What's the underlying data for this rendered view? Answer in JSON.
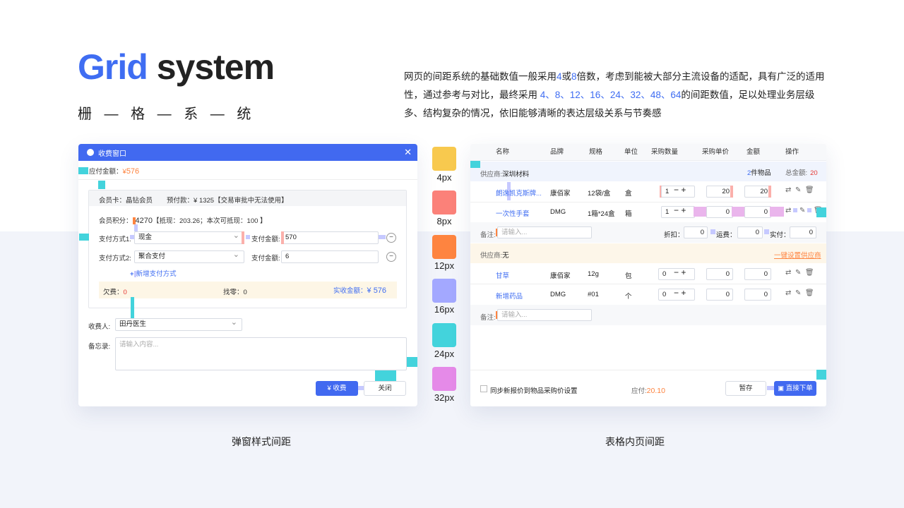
{
  "header": {
    "title_part1": "Grid",
    "title_part2": "system",
    "subtitle": "栅 — 格 — 系 — 统",
    "desc_a": "网页的间距系统的基础数值一般采用",
    "desc_4": "4",
    "desc_b": "或",
    "desc_8": "8",
    "desc_c": "倍数，考虑到能被大部分主流设备的适配，具有广泛的适用性，通过参考与对比，最终采用 ",
    "desc_vals": "4、8、12、16、24、32、48、64",
    "desc_d": "的间距数值，足以处理业务层级多、结构复杂的情况，依旧能够清晰的表达层级关系与节奏感"
  },
  "captions": {
    "dialog": "弹窗样式间距",
    "table": "表格内页间距"
  },
  "legend": [
    {
      "label": "4px",
      "color": "#f8c94e"
    },
    {
      "label": "8px",
      "color": "#fb8179"
    },
    {
      "label": "12px",
      "color": "#fe8440"
    },
    {
      "label": "16px",
      "color": "#a3a8ff"
    },
    {
      "label": "24px",
      "color": "#43d3dc"
    },
    {
      "label": "32px",
      "color": "#e58ae8"
    }
  ],
  "dialog": {
    "title": "收费窗口",
    "due_label": "应付金额：",
    "due_currency": "¥",
    "due_value": "576",
    "member_card_label": "会员卡：",
    "member_card_value": "晶钻会员",
    "prepaid_label": "预付款：",
    "prepaid_value": "¥ 1325【交易审批中无法使用】",
    "points_label": "会员积分：",
    "points_value": "4270",
    "points_note": "【抵现：203.26；本次可抵现：100 】",
    "pay1_label": "支付方式1:",
    "pay1_value": "现金",
    "pay1_amount_label": "支付金额:",
    "pay1_amount": "570",
    "pay2_label": "支付方式2:",
    "pay2_value": "聚合支付",
    "pay2_amount_label": "支付金额:",
    "pay2_amount": "6",
    "add_pay": "新增支付方式",
    "owe_label": "欠费：",
    "owe_value": "0",
    "change_label": "找零：",
    "change_value": "0",
    "received_label": "实收金额：",
    "received_value": "¥ 576",
    "cashier_label": "收费人:",
    "cashier_value": "田丹医生",
    "memo_label": "备忘录:",
    "memo_placeholder": "请输入内容...",
    "charge_button": "¥ 收费",
    "close_button": "关闭"
  },
  "table": {
    "headers": [
      "名称",
      "品牌",
      "规格",
      "单位",
      "采购数量",
      "采购单价",
      "金额",
      "操作"
    ],
    "supplier1_label": "供应商:",
    "supplier1_name": "深圳材料",
    "supplier1_count": "2",
    "supplier1_count_unit": "件物品",
    "supplier1_total_label": "总金额:",
    "supplier1_total": "20",
    "rows1": [
      {
        "name": "朗逸凯克斯牌...",
        "brand": "康佰家",
        "spec": "12袋/盒",
        "unit": "盒",
        "qty": "1",
        "price": "20",
        "amount": "20"
      },
      {
        "name": "一次性手套",
        "brand": "DMG",
        "spec": "1箱*24盒",
        "unit": "箱",
        "qty": "1",
        "price": "0",
        "amount": "0"
      }
    ],
    "note_label": "备注:",
    "note_placeholder": "请输入...",
    "discount_label": "折扣：",
    "discount_value": "0",
    "freight_label": "运费：",
    "freight_value": "0",
    "paid_label": "实付：",
    "paid_value": "0",
    "supplier2_label": "供应商:",
    "supplier2_name": "无",
    "set_supplier": "一键设置供应商",
    "rows2": [
      {
        "name": "甘草",
        "brand": "康佰家",
        "spec": "12g",
        "unit": "包",
        "qty": "0",
        "price": "0",
        "amount": "0"
      },
      {
        "name": "新增药品",
        "brand": "DMG",
        "spec": "#01",
        "unit": "个",
        "qty": "0",
        "price": "0",
        "amount": "0"
      }
    ],
    "note2_label": "备注:",
    "note2_placeholder": "请输入...",
    "sync_label": "同步新报价到物品采购价设置",
    "payable_label": "应付:",
    "payable_value": "20.10",
    "save_button": "暂存",
    "order_button": "直接下单"
  }
}
